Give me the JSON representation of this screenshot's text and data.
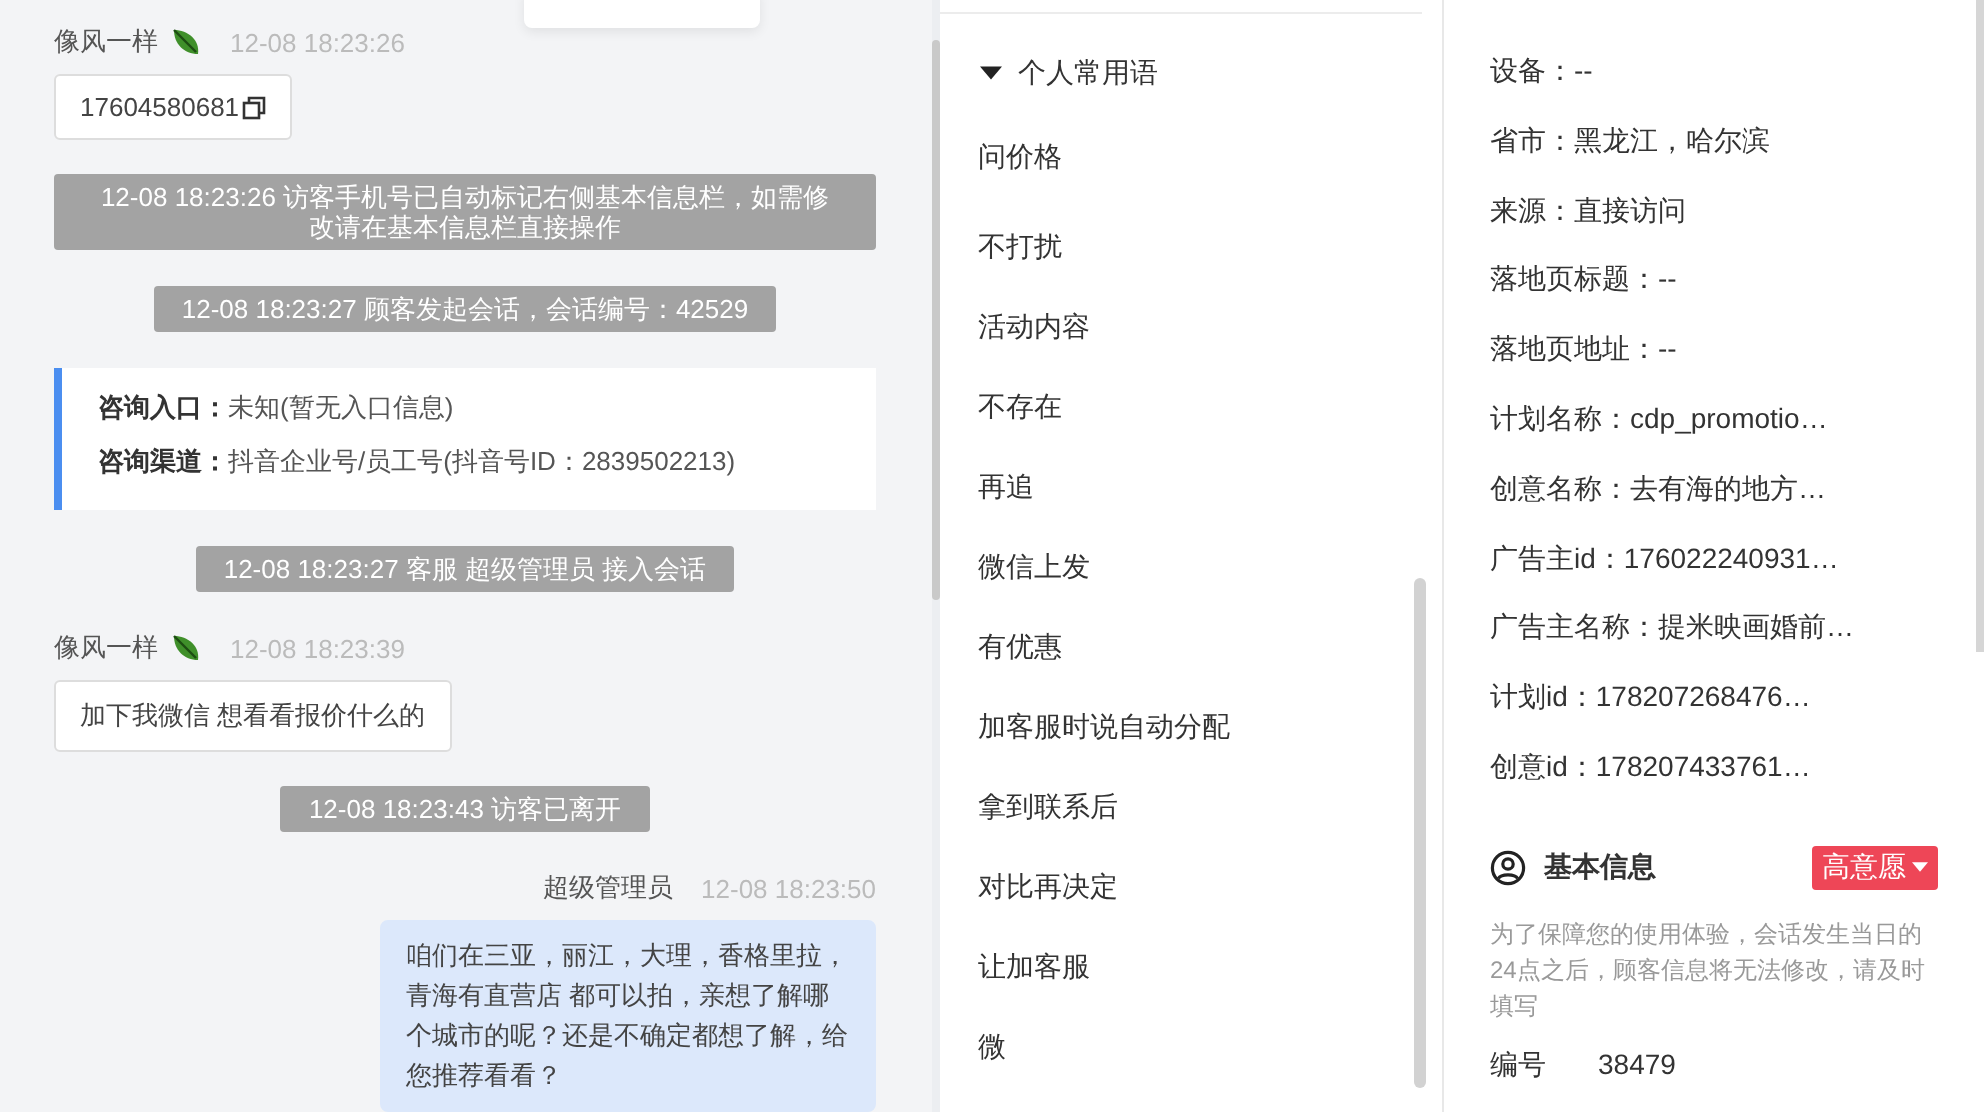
{
  "chat": {
    "messages": [
      {
        "kind": "phone",
        "sender": "像风一样",
        "time": "12-08 18:23:26",
        "text": "17604580681"
      },
      {
        "kind": "system",
        "text": "12-08 18:23:26 访客手机号已自动标记右侧基本信息栏，如需修改请在基本信息栏直接操作"
      },
      {
        "kind": "system",
        "text": "12-08 18:23:27 顾客发起会话，会话编号：42529"
      },
      {
        "kind": "entry",
        "lines": [
          {
            "label": "咨询入口：",
            "value": "未知(暂无入口信息)"
          },
          {
            "label": "咨询渠道：",
            "value": "抖音企业号/员工号(抖音号ID：2839502213)"
          }
        ]
      },
      {
        "kind": "system",
        "text": "12-08 18:23:27 客服 超级管理员 接入会话"
      },
      {
        "kind": "visitor",
        "sender": "像风一样",
        "time": "12-08 18:23:39",
        "text": "加下我微信   想看看报价什么的"
      },
      {
        "kind": "system",
        "text": "12-08 18:23:43 访客已离开"
      },
      {
        "kind": "agent",
        "sender": "超级管理员",
        "time": "12-08 18:23:50",
        "text": "咱们在三亚，丽江，大理，香格里拉，青海有直营店 都可以拍，亲想了解哪个城市的呢？还是不确定都想了解，给您推荐看看？"
      }
    ]
  },
  "phrases": {
    "group": {
      "label": "个人常用语",
      "expanded": true
    },
    "items": [
      "问价格",
      "不打扰",
      "活动内容",
      "不存在",
      "再追",
      "微信上发",
      "有优惠",
      "加客服时说自动分配",
      "拿到联系后",
      "对比再决定",
      "让加客服",
      "微"
    ]
  },
  "info": {
    "items": [
      "设备：--",
      "省市：黑龙江，哈尔滨",
      "来源：直接访问",
      "落地页标题：--",
      "落地页地址：--",
      "计划名称：cdp_promotio…",
      "创意名称：去有海的地方…",
      "广告主id：176022240931…",
      "广告主名称：提米映画婚前…",
      "计划id：178207268476…",
      "创意id：178207433761…"
    ],
    "basic": {
      "title": "基本信息",
      "tag": "高意愿",
      "notice": "为了保障您的使用体验，会话发生当日的24点之后，顾客信息将无法修改，请及时填写",
      "fields": [
        {
          "label": "编号",
          "value": "38479"
        }
      ]
    }
  }
}
